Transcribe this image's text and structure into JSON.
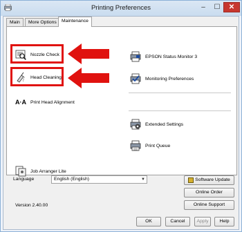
{
  "window": {
    "title": "Printing Preferences",
    "close_glyph": "✕",
    "min_glyph": "–",
    "max_glyph": "☐"
  },
  "tabs": [
    {
      "label": "Main",
      "active": false
    },
    {
      "label": "More Options",
      "active": false
    },
    {
      "label": "Maintenance",
      "active": true
    }
  ],
  "maintenance": {
    "left_items": [
      {
        "label": "Nozzle Check",
        "icon": "nozzle-check-icon"
      },
      {
        "label": "Head Cleaning",
        "icon": "head-cleaning-icon"
      },
      {
        "label": "Print Head Alignment",
        "icon": "print-head-alignment-icon"
      },
      {
        "label": "Job Arranger Lite",
        "icon": "job-arranger-lite-icon"
      }
    ],
    "right_items": [
      {
        "label": "EPSON Status Monitor 3",
        "icon": "status-monitor-icon"
      },
      {
        "label": "Monitoring Preferences",
        "icon": "monitoring-preferences-icon"
      },
      {
        "label": "Extended Settings",
        "icon": "extended-settings-icon"
      },
      {
        "label": "Print Queue",
        "icon": "print-queue-icon"
      }
    ],
    "alignment_glyph": "A·A"
  },
  "language": {
    "label": "Language",
    "selected": "English (English)"
  },
  "version": "Version 2.40.00",
  "buttons": {
    "software_update": "Software Update",
    "online_order": "Online Order",
    "online_support": "Online Support",
    "ok": "OK",
    "cancel": "Cancel",
    "apply": "Apply",
    "help": "Help"
  },
  "colors": {
    "highlight": "#e0120f",
    "title_bg": "#dbe7f4",
    "close_bg": "#c7372f"
  }
}
